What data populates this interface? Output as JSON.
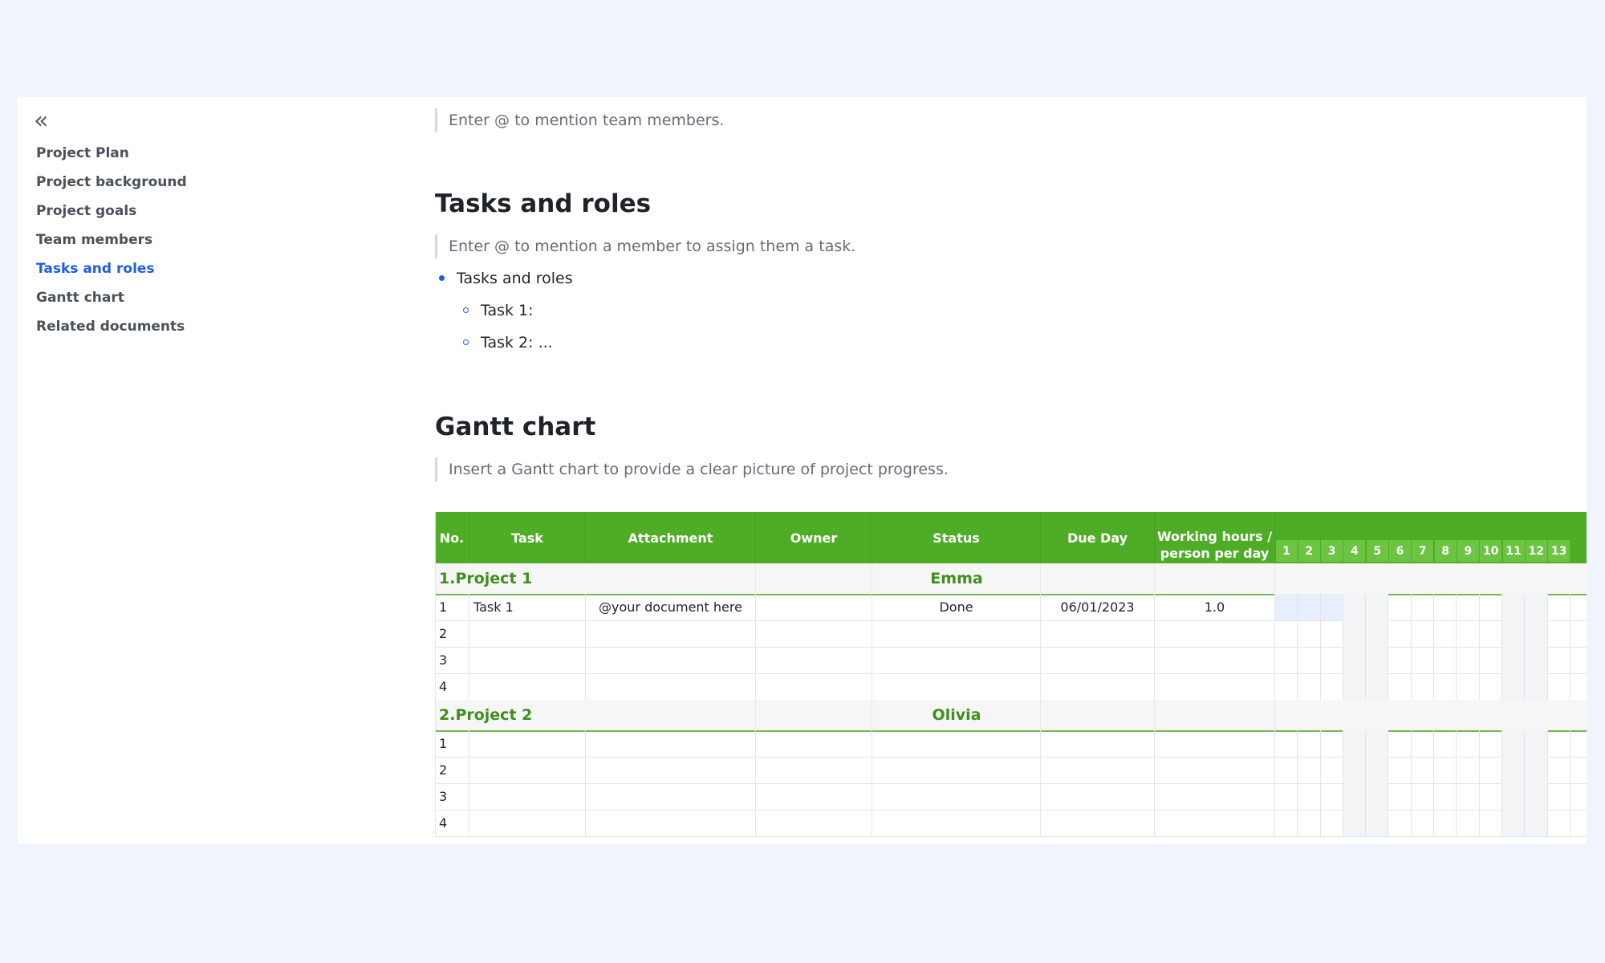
{
  "sidebar": {
    "collapse_icon": "«",
    "items": [
      {
        "label": "Project Plan"
      },
      {
        "label": "Project background"
      },
      {
        "label": "Project goals"
      },
      {
        "label": "Team members"
      },
      {
        "label": "Tasks and roles",
        "active": true
      },
      {
        "label": "Gantt chart"
      },
      {
        "label": "Related documents"
      }
    ]
  },
  "team_members": {
    "placeholder": "Enter @ to mention team members."
  },
  "tasks_roles": {
    "heading": "Tasks and roles",
    "placeholder": "Enter @ to mention a member to assign them a task.",
    "bullet": "Tasks and roles",
    "sub_bullets": [
      "Task 1:",
      "Task 2: ..."
    ]
  },
  "gantt": {
    "heading": "Gantt chart",
    "placeholder": "Insert a Gantt chart to provide a clear picture of project progress.",
    "columns": {
      "no": "No.",
      "task": "Task",
      "attachment": "Attachment",
      "owner": "Owner",
      "status": "Status",
      "due_day": "Due Day",
      "hours_line1": "Working hours /",
      "hours_line2": "person per day"
    },
    "days": [
      "1",
      "2",
      "3",
      "4",
      "5",
      "6",
      "7",
      "8",
      "9",
      "10",
      "11",
      "12",
      "13"
    ],
    "groups": [
      {
        "title": "1.Project 1",
        "owner": "Emma",
        "rows": [
          {
            "no": "1",
            "task": "Task 1",
            "attachment": "@your document here",
            "owner": "",
            "status": "Done",
            "due": "06/01/2023",
            "hours": "1.0"
          },
          {
            "no": "2",
            "task": "",
            "attachment": "",
            "owner": "",
            "status": "",
            "due": "",
            "hours": ""
          },
          {
            "no": "3",
            "task": "",
            "attachment": "",
            "owner": "",
            "status": "",
            "due": "",
            "hours": ""
          },
          {
            "no": "4",
            "task": "",
            "attachment": "",
            "owner": "",
            "status": "",
            "due": "",
            "hours": ""
          }
        ]
      },
      {
        "title": "2.Project 2",
        "owner": "Olivia",
        "rows": [
          {
            "no": "1",
            "task": "",
            "attachment": "",
            "owner": "",
            "status": "",
            "due": "",
            "hours": ""
          },
          {
            "no": "2",
            "task": "",
            "attachment": "",
            "owner": "",
            "status": "",
            "due": "",
            "hours": ""
          },
          {
            "no": "3",
            "task": "",
            "attachment": "",
            "owner": "",
            "status": "",
            "due": "",
            "hours": ""
          },
          {
            "no": "4",
            "task": "",
            "attachment": "",
            "owner": "",
            "status": "",
            "due": "",
            "hours": ""
          }
        ]
      }
    ],
    "highlight": {
      "group": 0,
      "row": 0,
      "days": 3
    },
    "colors": {
      "header": "#4fac27",
      "day_header": "#6cc442",
      "group_text": "#3f8f1c",
      "highlight": "#e7eefc"
    }
  }
}
